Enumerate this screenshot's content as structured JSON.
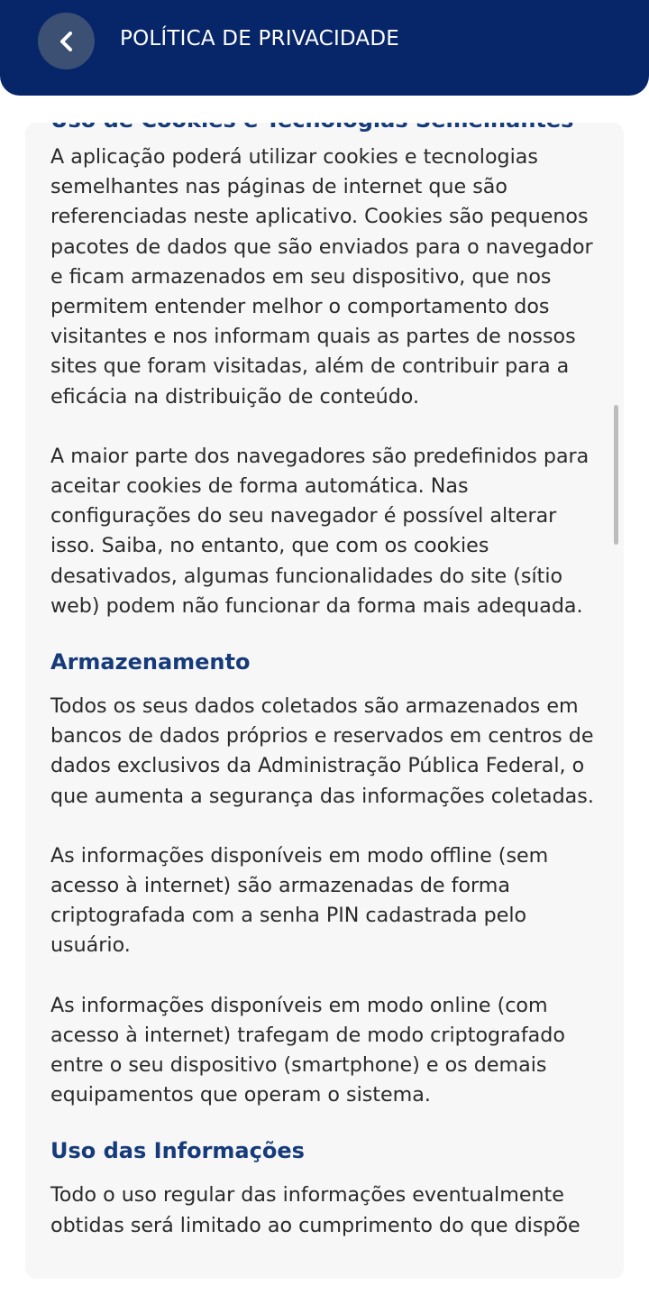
{
  "header": {
    "title": "POLÍTICA DE PRIVACIDADE",
    "back_icon": "chevron-left-icon",
    "background_color": "#07266a"
  },
  "content": {
    "clipped_heading": "Uso de Cookies e Tecnologias Semelhantes",
    "cookies_paragraph_1": "A aplicação poderá utilizar cookies e tecnologias semelhantes nas páginas de internet que são referenciadas neste aplicativo. Cookies são pequenos pacotes de dados que são enviados para o navegador e ficam armazenados em seu dispositivo, que nos permitem entender melhor o comportamento dos visitantes e nos informam quais as partes de nossos sites que foram visitadas, além de contribuir para a eficácia na distribuição de conteúdo.",
    "cookies_paragraph_2": "A maior parte dos navegadores são predefinidos para aceitar cookies de forma automática. Nas configurações do seu navegador é possível alterar isso. Saiba, no entanto, que com os cookies desativados, algumas funcionalidades do site (sítio web) podem não funcionar da forma mais adequada.",
    "storage_title": "Armazenamento",
    "storage_paragraph_1": "Todos os seus dados coletados são armazenados em bancos de dados próprios e reservados em centros de dados exclusivos da Administração Pública Federal, o que aumenta a segurança das informações coletadas.",
    "storage_paragraph_2": "As informações disponíveis em modo offline (sem acesso à internet) são armazenadas de forma criptografada com a senha PIN cadastrada pelo usuário.",
    "storage_paragraph_3": "As informações disponíveis em modo online (com acesso à internet) trafegam de modo criptografado entre o seu dispositivo (smartphone) e os demais equipamentos que operam o sistema.",
    "usage_title": "Uso das Informações",
    "usage_paragraph_1": "Todo o uso regular das informações eventualmente obtidas será limitado ao cumprimento do que dispõe"
  },
  "colors": {
    "accent": "#163b7a",
    "card_background": "#f7f7f7",
    "text": "#2a2a2a"
  }
}
